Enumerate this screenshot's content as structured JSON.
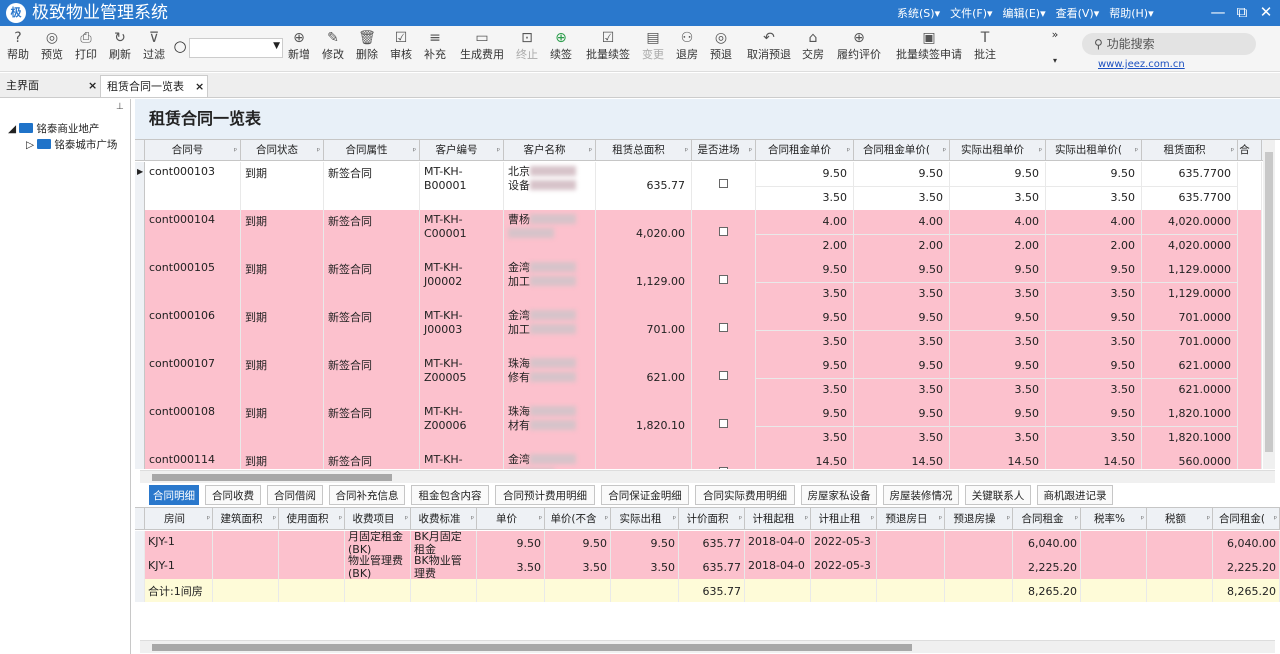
{
  "app": {
    "title": "极致物业管理系统",
    "logo_text": "极"
  },
  "menus": [
    "系统(S)▾",
    "文件(F)▾",
    "编辑(E)▾",
    "查看(V)▾",
    "帮助(H)▾"
  ],
  "toolbar": [
    {
      "label": "帮助",
      "icon": "?"
    },
    {
      "label": "预览",
      "icon": "◎"
    },
    {
      "label": "打印",
      "icon": "⎙"
    },
    {
      "label": "刷新",
      "icon": "↻"
    },
    {
      "label": "过滤",
      "icon": "⊽"
    },
    {
      "label": "新增",
      "icon": "⊕"
    },
    {
      "label": "修改",
      "icon": "✎"
    },
    {
      "label": "删除",
      "icon": "🗑"
    },
    {
      "label": "审核",
      "icon": "☑"
    },
    {
      "label": "补充",
      "icon": "≡"
    },
    {
      "label": "生成费用",
      "icon": "▭"
    },
    {
      "label": "终止",
      "icon": "⊡"
    },
    {
      "label": "续签",
      "icon": "⊕"
    },
    {
      "label": "批量续签",
      "icon": "☑"
    },
    {
      "label": "变更",
      "icon": "▤"
    },
    {
      "label": "退房",
      "icon": "⚇"
    },
    {
      "label": "预退",
      "icon": "◎"
    },
    {
      "label": "取消预退",
      "icon": "↶"
    },
    {
      "label": "交房",
      "icon": "⌂"
    },
    {
      "label": "履约评价",
      "icon": "⊕"
    },
    {
      "label": "批量续签申请",
      "icon": "▣"
    },
    {
      "label": "批注",
      "icon": "T"
    }
  ],
  "function_search": "功能搜索",
  "website": "www.jeez.com.cn",
  "tabs": [
    {
      "label": "主界面"
    },
    {
      "label": "租赁合同一览表"
    }
  ],
  "tree": {
    "root": "铭泰商业地产",
    "child": "铭泰城市广场"
  },
  "page_title": "租赁合同一览表",
  "columns": [
    "合同号",
    "合同状态",
    "合同属性",
    "客户编号",
    "客户名称",
    "租赁总面积",
    "是否进场",
    "合同租金单价",
    "合同租金单价(",
    "实际出租单价",
    "实际出租单价(",
    "租赁面积",
    "合"
  ],
  "rows": [
    {
      "id": "cont000103",
      "status": "到期",
      "attr": "新签合同",
      "cust_no": [
        "MT-KH-",
        "B00001"
      ],
      "cust_name": [
        "北京",
        "设备"
      ],
      "area": "635.77",
      "lines": [
        [
          "9.50",
          "9.50",
          "9.50",
          "9.50",
          "635.7700"
        ],
        [
          "3.50",
          "3.50",
          "3.50",
          "3.50",
          "635.7700"
        ]
      ]
    },
    {
      "id": "cont000104",
      "status": "到期",
      "attr": "新签合同",
      "cust_no": [
        "MT-KH-",
        "C00001"
      ],
      "cust_name": [
        "曹杨",
        ""
      ],
      "area": "4,020.00",
      "lines": [
        [
          "4.00",
          "4.00",
          "4.00",
          "4.00",
          "4,020.0000"
        ],
        [
          "2.00",
          "2.00",
          "2.00",
          "2.00",
          "4,020.0000"
        ]
      ]
    },
    {
      "id": "cont000105",
      "status": "到期",
      "attr": "新签合同",
      "cust_no": [
        "MT-KH-",
        "J00002"
      ],
      "cust_name": [
        "金湾",
        "加工"
      ],
      "area": "1,129.00",
      "lines": [
        [
          "9.50",
          "9.50",
          "9.50",
          "9.50",
          "1,129.0000"
        ],
        [
          "3.50",
          "3.50",
          "3.50",
          "3.50",
          "1,129.0000"
        ]
      ]
    },
    {
      "id": "cont000106",
      "status": "到期",
      "attr": "新签合同",
      "cust_no": [
        "MT-KH-",
        "J00003"
      ],
      "cust_name": [
        "金湾",
        "加工"
      ],
      "area": "701.00",
      "lines": [
        [
          "9.50",
          "9.50",
          "9.50",
          "9.50",
          "701.0000"
        ],
        [
          "3.50",
          "3.50",
          "3.50",
          "3.50",
          "701.0000"
        ]
      ]
    },
    {
      "id": "cont000107",
      "status": "到期",
      "attr": "新签合同",
      "cust_no": [
        "MT-KH-",
        "Z00005"
      ],
      "cust_name": [
        "珠海",
        "修有"
      ],
      "area": "621.00",
      "lines": [
        [
          "9.50",
          "9.50",
          "9.50",
          "9.50",
          "621.0000"
        ],
        [
          "3.50",
          "3.50",
          "3.50",
          "3.50",
          "621.0000"
        ]
      ]
    },
    {
      "id": "cont000108",
      "status": "到期",
      "attr": "新签合同",
      "cust_no": [
        "MT-KH-",
        "Z00006"
      ],
      "cust_name": [
        "珠海",
        "材有"
      ],
      "area": "1,820.10",
      "lines": [
        [
          "9.50",
          "9.50",
          "9.50",
          "9.50",
          "1,820.1000"
        ],
        [
          "3.50",
          "3.50",
          "3.50",
          "3.50",
          "1,820.1000"
        ]
      ]
    },
    {
      "id": "cont000114",
      "status": "到期",
      "attr": "新签合同",
      "cust_no": [
        "MT-KH-",
        ""
      ],
      "cust_name": [
        "金湾",
        ""
      ],
      "area": "560.00",
      "lines": [
        [
          "14.50",
          "14.50",
          "14.50",
          "14.50",
          "560.0000"
        ],
        [
          "",
          "",
          "",
          "",
          ""
        ]
      ]
    }
  ],
  "sub_tabs": [
    "合同明细",
    "合同收费",
    "合同借阅",
    "合同补充信息",
    "租金包含内容",
    "合同预计费用明细",
    "合同保证金明细",
    "合同实际费用明细",
    "房屋家私设备",
    "房屋装修情况",
    "关键联系人",
    "商机跟进记录"
  ],
  "detail_columns": [
    "房间",
    "建筑面积",
    "使用面积",
    "收费项目",
    "收费标准",
    "单价",
    "单价(不含",
    "实际出租",
    "计价面积",
    "计租起租",
    "计租止租",
    "预退房日",
    "预退房操",
    "合同租金",
    "税率%",
    "税额",
    "合同租金("
  ],
  "detail_rows": [
    [
      "KJY-1",
      "",
      "",
      "月固定租金\n(BK)",
      "BK月固定\n租金",
      "9.50",
      "9.50",
      "9.50",
      "635.77",
      "2018-04-0",
      "2022-05-3",
      "",
      "",
      "6,040.00",
      "",
      "",
      "6,040.00"
    ],
    [
      "KJY-1",
      "",
      "",
      "物业管理费\n(BK)",
      "BK物业管\n理费",
      "3.50",
      "3.50",
      "3.50",
      "635.77",
      "2018-04-0",
      "2022-05-3",
      "",
      "",
      "2,225.20",
      "",
      "",
      "2,225.20"
    ]
  ],
  "detail_total": [
    "合计:1间房",
    "",
    "",
    "",
    "",
    "",
    "",
    "",
    "635.77",
    "",
    "",
    "",
    "",
    "8,265.20",
    "",
    "",
    "8,265.20"
  ]
}
